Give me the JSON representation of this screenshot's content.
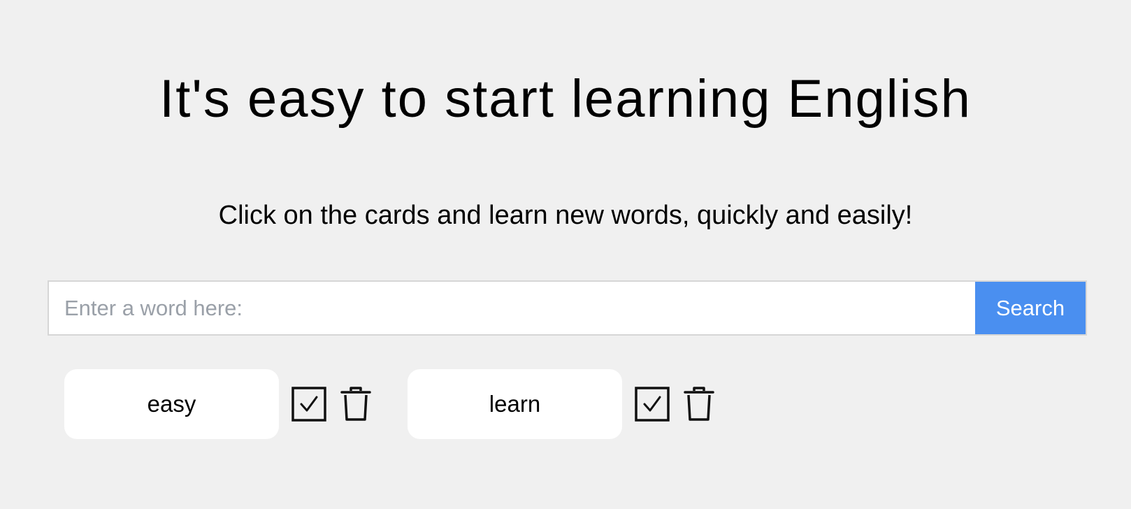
{
  "header": {
    "title": "It's easy to start learning English",
    "subtitle": "Click on the cards and learn new words, quickly and easily!"
  },
  "search": {
    "value": "",
    "placeholder": "Enter a word here:",
    "button_label": "Search"
  },
  "cards": [
    {
      "word": "easy",
      "check_icon": "checkbox-checked-icon",
      "delete_icon": "trash-icon"
    },
    {
      "word": "learn",
      "check_icon": "checkbox-checked-icon",
      "delete_icon": "trash-icon"
    }
  ],
  "colors": {
    "background": "#f0f0f0",
    "search_button": "#4a8ff0",
    "card": "#ffffff"
  }
}
